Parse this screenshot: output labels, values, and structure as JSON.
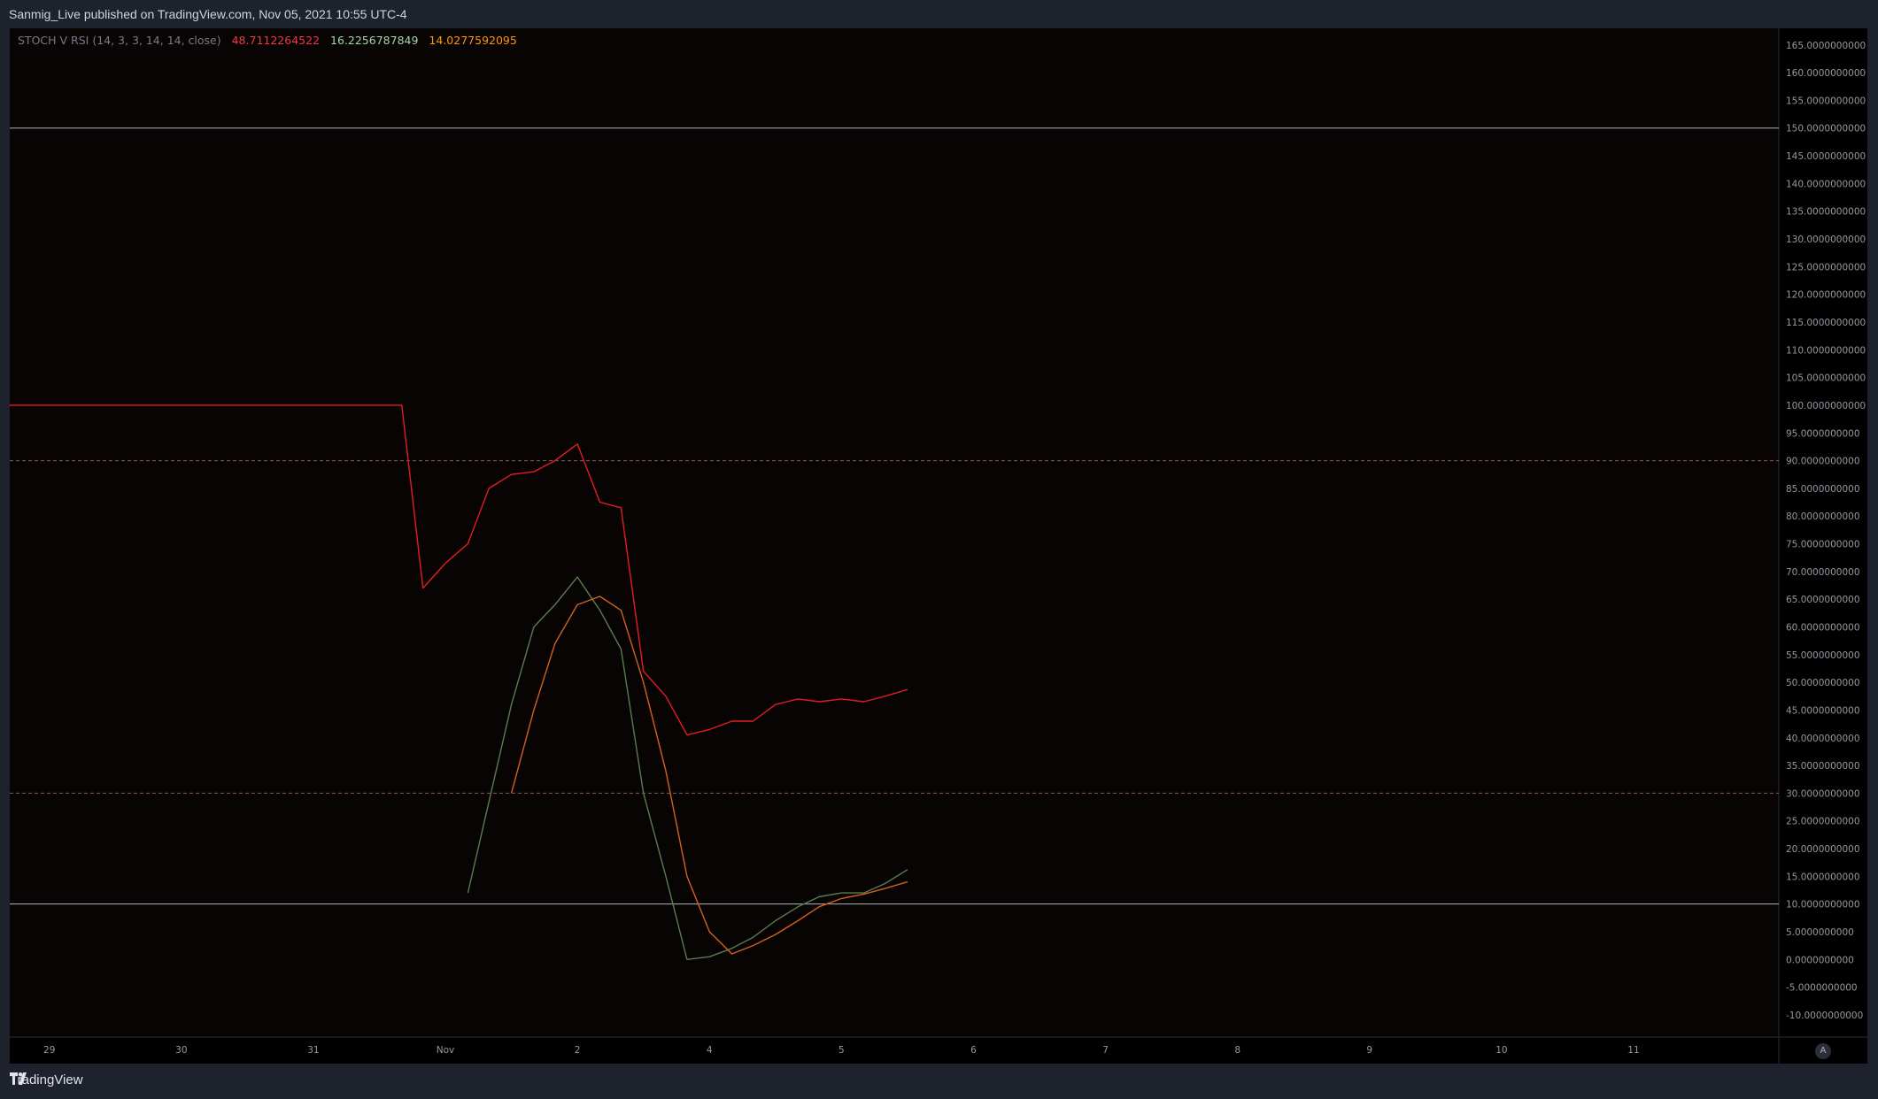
{
  "header": {
    "publish_text": "Sanmig_Live published on TradingView.com, Nov 05, 2021 10:55 UTC-4"
  },
  "legend": {
    "indicator": "STOCH V RSI (14, 3, 3, 14, 14, close)",
    "values": [
      {
        "text": "48.7112264522",
        "color": "#f23645"
      },
      {
        "text": "16.2256787849",
        "color": "#a5d6a7"
      },
      {
        "text": "14.0277592095",
        "color": "#ff9800"
      }
    ]
  },
  "footer": {
    "brand": "TradingView",
    "auto_label": "A"
  },
  "colors": {
    "red_line": "#e31c24",
    "green_line": "#5a7d4e",
    "orange_line": "#d2611e",
    "band": "#b2b5be",
    "dashed": "#8a5a52",
    "plot_bg": "#080404"
  },
  "chart_data": {
    "type": "line",
    "y_axis": {
      "ylim": [
        -14,
        168
      ],
      "ticks": [
        165,
        160,
        155,
        150,
        145,
        140,
        135,
        130,
        125,
        120,
        115,
        110,
        105,
        100,
        95,
        90,
        85,
        80,
        75,
        70,
        65,
        60,
        55,
        50,
        45,
        40,
        35,
        30,
        25,
        20,
        15,
        10,
        5,
        0,
        -5,
        -10
      ],
      "tick_labels": [
        "165.0000000000",
        "160.0000000000",
        "155.0000000000",
        "150.0000000000",
        "145.0000000000",
        "140.0000000000",
        "135.0000000000",
        "130.0000000000",
        "125.0000000000",
        "120.0000000000",
        "115.0000000000",
        "110.0000000000",
        "105.0000000000",
        "100.0000000000",
        "95.0000000000",
        "90.0000000000",
        "85.0000000000",
        "80.0000000000",
        "75.0000000000",
        "70.0000000000",
        "65.0000000000",
        "60.0000000000",
        "55.0000000000",
        "50.0000000000",
        "45.0000000000",
        "40.0000000000",
        "35.0000000000",
        "30.0000000000",
        "25.0000000000",
        "20.0000000000",
        "15.0000000000",
        "10.0000000000",
        "5.0000000000",
        "0.0000000000",
        "-5.0000000000",
        "-10.0000000000"
      ]
    },
    "x_axis": {
      "xlim": [
        28.7,
        42.1
      ],
      "ticks": [
        {
          "x": 29,
          "label": "29"
        },
        {
          "x": 30,
          "label": "30"
        },
        {
          "x": 31,
          "label": "31"
        },
        {
          "x": 32,
          "label": "Nov"
        },
        {
          "x": 33,
          "label": "2"
        },
        {
          "x": 34,
          "label": "4"
        },
        {
          "x": 35,
          "label": "5"
        },
        {
          "x": 36,
          "label": "6"
        },
        {
          "x": 37,
          "label": "7"
        },
        {
          "x": 38,
          "label": "8"
        },
        {
          "x": 39,
          "label": "9"
        },
        {
          "x": 40,
          "label": "10"
        },
        {
          "x": 41,
          "label": "11"
        }
      ]
    },
    "bands": [
      {
        "y": 150,
        "style": "solid"
      },
      {
        "y": 90,
        "style": "dashed"
      },
      {
        "y": 30,
        "style": "dashed"
      },
      {
        "y": 10,
        "style": "solid"
      }
    ],
    "series": [
      {
        "color_key": "red_line",
        "points": [
          [
            28.7,
            100
          ],
          [
            31.67,
            100
          ],
          [
            31.83,
            67
          ],
          [
            32.0,
            71.5
          ],
          [
            32.17,
            75
          ],
          [
            32.33,
            85
          ],
          [
            32.5,
            87.5
          ],
          [
            32.67,
            88
          ],
          [
            32.83,
            90
          ],
          [
            33.0,
            93
          ],
          [
            33.17,
            82.5
          ],
          [
            33.33,
            81.5
          ],
          [
            33.5,
            52
          ],
          [
            33.67,
            47.5
          ],
          [
            33.83,
            40.5
          ],
          [
            34.0,
            41.5
          ],
          [
            34.17,
            43
          ],
          [
            34.33,
            43
          ],
          [
            34.5,
            46
          ],
          [
            34.67,
            47
          ],
          [
            34.83,
            46.5
          ],
          [
            35.0,
            47
          ],
          [
            35.17,
            46.5
          ],
          [
            35.33,
            47.5
          ],
          [
            35.5,
            48.7
          ]
        ]
      },
      {
        "color_key": "green_line",
        "points": [
          [
            32.17,
            12
          ],
          [
            32.5,
            46
          ],
          [
            32.67,
            60
          ],
          [
            32.83,
            64
          ],
          [
            33.0,
            69
          ],
          [
            33.17,
            63
          ],
          [
            33.33,
            56
          ],
          [
            33.5,
            30
          ],
          [
            33.67,
            15
          ],
          [
            33.83,
            0
          ],
          [
            34.0,
            0.5
          ],
          [
            34.17,
            2
          ],
          [
            34.33,
            4
          ],
          [
            34.5,
            7
          ],
          [
            34.67,
            9.5
          ],
          [
            34.83,
            11.3
          ],
          [
            35.0,
            12
          ],
          [
            35.17,
            12
          ],
          [
            35.33,
            13.7
          ],
          [
            35.5,
            16.2
          ]
        ]
      },
      {
        "color_key": "orange_line",
        "points": [
          [
            32.5,
            30
          ],
          [
            32.67,
            45
          ],
          [
            32.83,
            57
          ],
          [
            33.0,
            64
          ],
          [
            33.17,
            65.5
          ],
          [
            33.33,
            63
          ],
          [
            33.5,
            50
          ],
          [
            33.67,
            34
          ],
          [
            33.83,
            15
          ],
          [
            34.0,
            5
          ],
          [
            34.17,
            1
          ],
          [
            34.33,
            2.5
          ],
          [
            34.5,
            4.5
          ],
          [
            34.67,
            7
          ],
          [
            34.83,
            9.5
          ],
          [
            35.0,
            11
          ],
          [
            35.17,
            11.8
          ],
          [
            35.33,
            12.8
          ],
          [
            35.5,
            14
          ]
        ]
      }
    ]
  }
}
